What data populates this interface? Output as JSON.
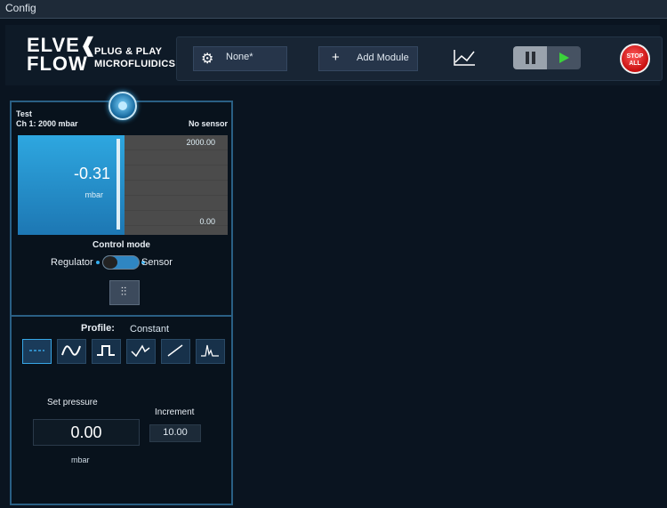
{
  "menubar": {
    "config_label": "Config"
  },
  "logo": {
    "word1": "ELVE❰",
    "word2": "FLOW",
    "tag_line1": "PLUG & PLAY",
    "tag_line2": "MICROFLUIDICS"
  },
  "toolbar": {
    "config_value": "None*",
    "add_module_label": "Add Module",
    "stop_line1": "STOP",
    "stop_line2": "ALL",
    "icons": [
      "gears-icon",
      "plus-icon",
      "graph-icon",
      "pause-icon",
      "play-icon",
      "stop-all-icon"
    ]
  },
  "channel": {
    "name": "Test",
    "channel_label": "Ch 1: 2000 mbar",
    "sensor_label": "No sensor",
    "gauge_max": "2000.00",
    "gauge_value": "-0.31",
    "gauge_unit": "mbar",
    "gauge_min": "0.00",
    "control_mode_label": "Control mode",
    "regulator_label": "Regulator",
    "sensor_mode_label": "Sensor",
    "profile_label": "Profile:",
    "profile_value": "Constant",
    "profile_buttons": [
      "constant-icon",
      "sine-icon",
      "square-icon",
      "triangle-icon",
      "ramp-icon",
      "custom-icon"
    ],
    "set_pressure_label": "Set pressure",
    "increment_label": "Increment",
    "set_value": "0.00",
    "increment_value": "10.00",
    "set_unit": "mbar"
  },
  "colors": {
    "accent": "#2ea7e0",
    "panel_border": "#2a5f84",
    "stop": "#d81818",
    "play": "#3bd23b"
  }
}
